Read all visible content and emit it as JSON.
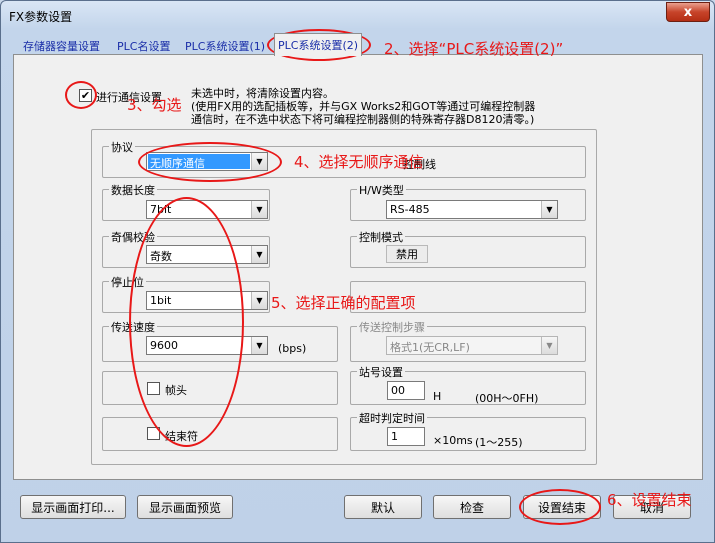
{
  "window": {
    "title": "FX参数设置",
    "close": "x"
  },
  "tabs": [
    {
      "label": "存储器容量设置"
    },
    {
      "label": "PLC名设置"
    },
    {
      "label": "PLC系统设置(1)"
    },
    {
      "label": "PLC系统设置(2)"
    }
  ],
  "comm": {
    "checkbox_label": "进行通信设置",
    "checked": true,
    "check_mark": "✔",
    "note_lines": [
      "未选中时，将清除设置内容。",
      "(使用FX用的选配插板等，并与GX Works2和GOT等通过可编程控制器",
      "通信时，在不选中状态下将可编程控制器侧的特殊寄存器D8120清零。)"
    ]
  },
  "protocol": {
    "label": "协议",
    "value": "无顺序通信",
    "side_text": "控制线"
  },
  "data_length": {
    "label": "数据长度",
    "value": "7bit"
  },
  "hw_type": {
    "label": "H/W类型",
    "value": "RS-485"
  },
  "parity": {
    "label": "奇偶校验",
    "value": "奇数"
  },
  "control_mode": {
    "label": "控制模式",
    "value": "禁用"
  },
  "stop_bit": {
    "label": "停止位",
    "value": "1bit"
  },
  "speed": {
    "label": "传送速度",
    "value": "9600",
    "unit": "(bps)"
  },
  "transmit_steps": {
    "label": "传送控制步骤",
    "value": "格式1(无CR,LF)"
  },
  "header": {
    "label": "帧头"
  },
  "station": {
    "label": "站号设置",
    "value": "00",
    "unit": "H",
    "range": "(00H～0FH)"
  },
  "terminator": {
    "label": "结束符"
  },
  "timeout": {
    "label": "超时判定时间",
    "value": "1",
    "unit": "×10ms",
    "range": "(1～255)"
  },
  "buttons": {
    "print": "显示画面打印...",
    "preview": "显示画面预览",
    "default": "默认",
    "check": "检查",
    "finish": "设置结束",
    "cancel": "取消"
  },
  "annotations": {
    "step2": "2、选择“PLC系统设置(2)”",
    "step3": "3、勾选",
    "step4": "4、选择无顺序通信",
    "step5": "5、选择正确的配置项",
    "step6": "6、设置结束"
  },
  "colors": {
    "annotation": "#e81818",
    "tab_text": "#1a2ea8",
    "selection": "#3399ff"
  }
}
